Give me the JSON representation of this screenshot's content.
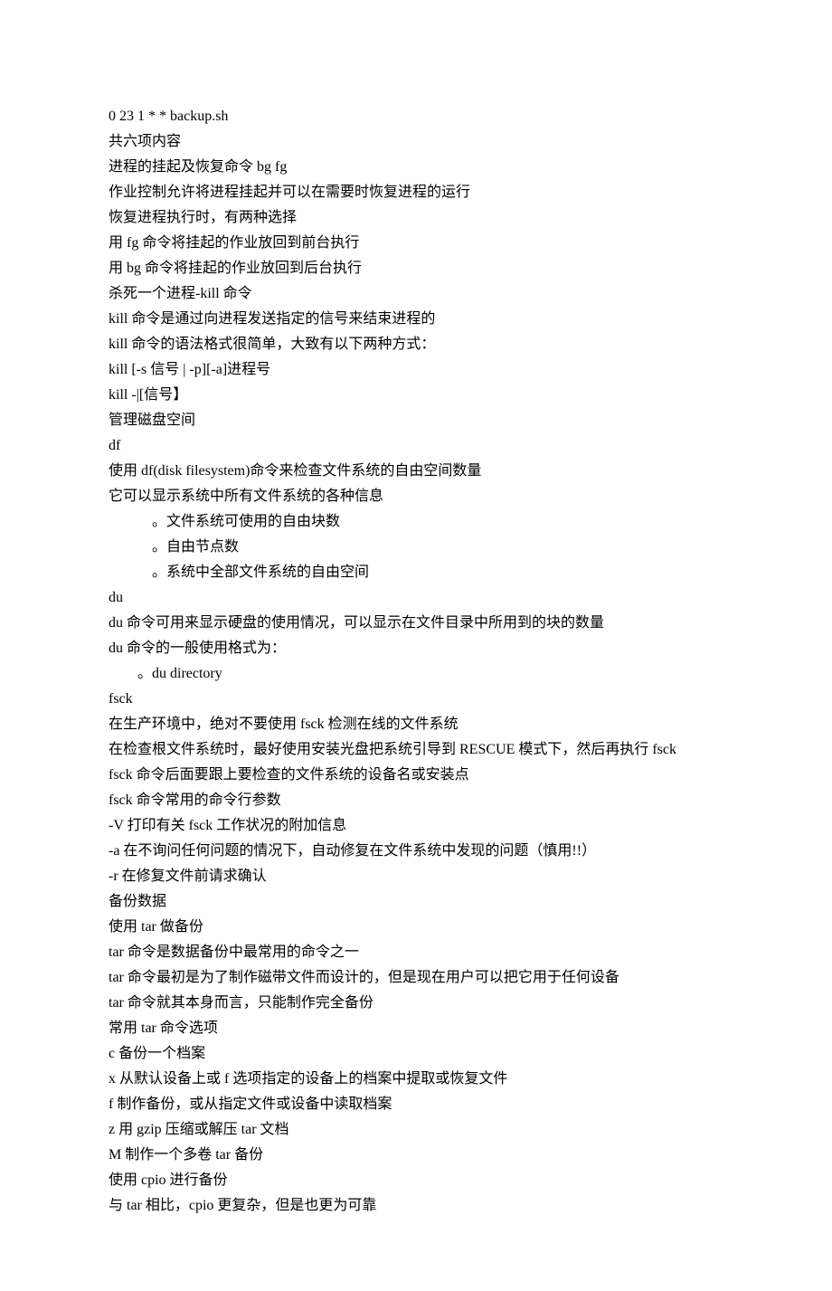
{
  "lines": [
    {
      "text": "0 23 1 * * backup.sh",
      "cls": ""
    },
    {
      "text": "共六项内容",
      "cls": ""
    },
    {
      "text": "进程的挂起及恢复命令 bg fg",
      "cls": ""
    },
    {
      "text": "作业控制允许将进程挂起并可以在需要时恢复进程的运行",
      "cls": ""
    },
    {
      "text": "恢复进程执行时，有两种选择",
      "cls": ""
    },
    {
      "text": "用 fg 命令将挂起的作业放回到前台执行",
      "cls": ""
    },
    {
      "text": "用 bg 命令将挂起的作业放回到后台执行",
      "cls": ""
    },
    {
      "text": "杀死一个进程-kill 命令",
      "cls": ""
    },
    {
      "text": "kill 命令是通过向进程发送指定的信号来结束进程的",
      "cls": ""
    },
    {
      "text": "kill 命令的语法格式很简单，大致有以下两种方式：",
      "cls": ""
    },
    {
      "text": "kill [-s 信号 | -p][-a]进程号",
      "cls": ""
    },
    {
      "text": "kill -|[信号】",
      "cls": ""
    },
    {
      "text": "管理磁盘空间",
      "cls": ""
    },
    {
      "text": "df",
      "cls": ""
    },
    {
      "text": "使用 df(disk filesystem)命令来检查文件系统的自由空间数量",
      "cls": ""
    },
    {
      "text": "它可以显示系统中所有文件系统的各种信息",
      "cls": ""
    },
    {
      "text": "。文件系统可使用的自由块数",
      "cls": "indent1"
    },
    {
      "text": "。自由节点数",
      "cls": "indent1"
    },
    {
      "text": "。系统中全部文件系统的自由空间",
      "cls": "indent1"
    },
    {
      "text": "du",
      "cls": ""
    },
    {
      "text": "du 命令可用来显示硬盘的使用情况，可以显示在文件目录中所用到的块的数量",
      "cls": ""
    },
    {
      "text": "du 命令的一般使用格式为：",
      "cls": ""
    },
    {
      "text": "。du directory",
      "cls": "indent2"
    },
    {
      "text": "fsck",
      "cls": ""
    },
    {
      "text": "在生产环境中，绝对不要使用 fsck 检测在线的文件系统",
      "cls": ""
    },
    {
      "text": "在检查根文件系统时，最好使用安装光盘把系统引导到 RESCUE 模式下，然后再执行 fsck",
      "cls": ""
    },
    {
      "text": "fsck 命令后面要跟上要检查的文件系统的设备名或安装点",
      "cls": ""
    },
    {
      "text": "fsck 命令常用的命令行参数",
      "cls": ""
    },
    {
      "text": "-V 打印有关 fsck 工作状况的附加信息",
      "cls": ""
    },
    {
      "text": "-a 在不询问任何问题的情况下，自动修复在文件系统中发现的问题（慎用!!）",
      "cls": ""
    },
    {
      "text": "-r 在修复文件前请求确认",
      "cls": ""
    },
    {
      "text": "备份数据",
      "cls": ""
    },
    {
      "text": "使用 tar 做备份",
      "cls": ""
    },
    {
      "text": "tar 命令是数据备份中最常用的命令之一",
      "cls": ""
    },
    {
      "text": "tar 命令最初是为了制作磁带文件而设计的，但是现在用户可以把它用于任何设备",
      "cls": ""
    },
    {
      "text": "tar 命令就其本身而言，只能制作完全备份",
      "cls": ""
    },
    {
      "text": "常用 tar 命令选项",
      "cls": ""
    },
    {
      "text": "c 备份一个档案",
      "cls": ""
    },
    {
      "text": "x 从默认设备上或 f 选项指定的设备上的档案中提取或恢复文件",
      "cls": ""
    },
    {
      "text": "f 制作备份，或从指定文件或设备中读取档案",
      "cls": ""
    },
    {
      "text": "z 用 gzip 压缩或解压 tar 文档",
      "cls": ""
    },
    {
      "text": "M 制作一个多卷 tar 备份",
      "cls": ""
    },
    {
      "text": "使用 cpio 进行备份",
      "cls": ""
    },
    {
      "text": "与 tar 相比，cpio 更复杂，但是也更为可靠",
      "cls": ""
    }
  ]
}
